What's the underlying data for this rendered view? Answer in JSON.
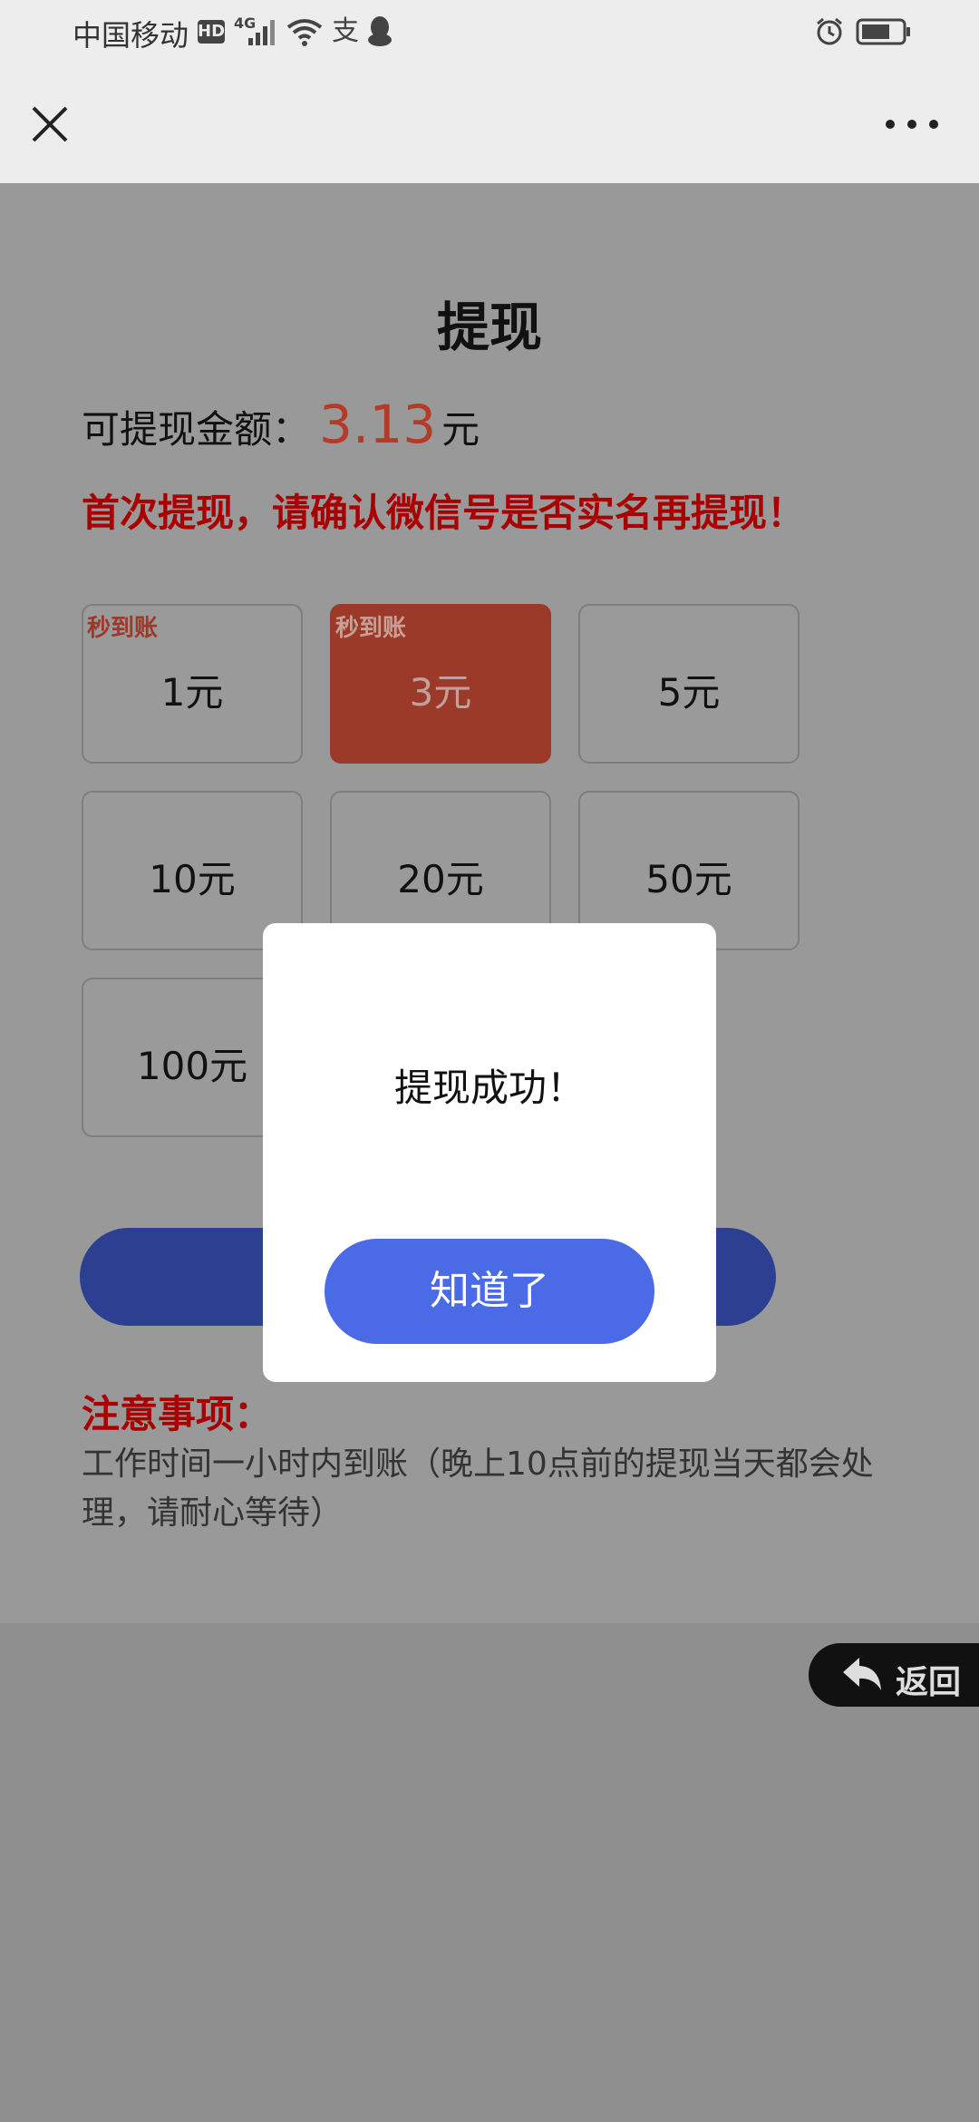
{
  "status_bar": {
    "carrier": "中国移动",
    "hd_label": "HD",
    "network_label": "4G",
    "app_icon_glyph": "支"
  },
  "page": {
    "title": "提现",
    "balance_label": "可提现金额：",
    "balance_value": "3.13",
    "balance_unit": "元",
    "warning": "首次提现，请确认微信号是否实名再提现！",
    "amounts": [
      {
        "label": "1元",
        "tag": "秒到账",
        "selected": false
      },
      {
        "label": "3元",
        "tag": "秒到账",
        "selected": true
      },
      {
        "label": "5元",
        "tag": "",
        "selected": false
      },
      {
        "label": "10元",
        "tag": "",
        "selected": false
      },
      {
        "label": "20元",
        "tag": "",
        "selected": false
      },
      {
        "label": "50元",
        "tag": "",
        "selected": false
      },
      {
        "label": "100元",
        "tag": "",
        "selected": false
      }
    ],
    "notes_title": "注意事项：",
    "notes_body": "工作时间一小时内到账（晚上10点前的提现当天都会处理，请耐心等待）"
  },
  "back_float": {
    "label": "返回"
  },
  "modal": {
    "message": "提现成功！",
    "confirm_label": "知道了"
  },
  "colors": {
    "accent_red": "#a80000",
    "selected_amount": "#9c3a2a",
    "confirm_blue": "#4b6be6",
    "submit_blue": "#2d3f91"
  }
}
